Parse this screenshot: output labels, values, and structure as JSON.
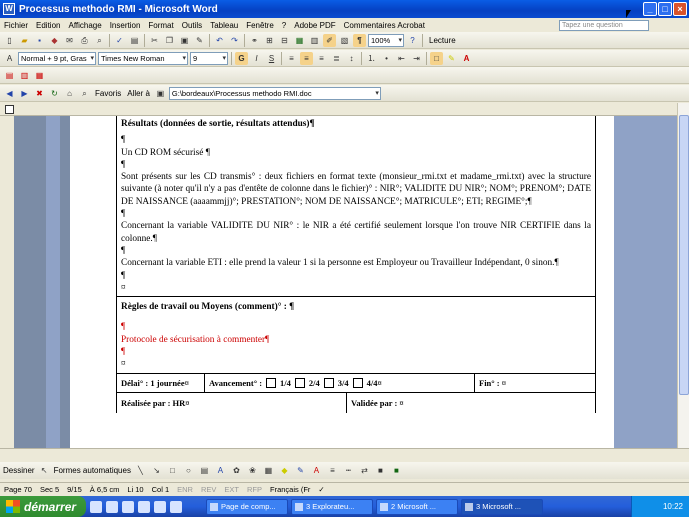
{
  "window": {
    "title": "Processus methodo RMI - Microsoft Word"
  },
  "menu": {
    "items": [
      "Fichier",
      "Edition",
      "Affichage",
      "Insertion",
      "Format",
      "Outils",
      "Tableau",
      "Fenêtre",
      "?",
      "Adobe PDF",
      "Commentaires Acrobat"
    ],
    "help_placeholder": "Tapez une question"
  },
  "toolbar": {
    "zoom": "100%",
    "lecture": "Lecture"
  },
  "format_toolbar": {
    "style": "Normal + 9 pt, Gras",
    "font": "Times New Roman",
    "size": "9",
    "bold": "G",
    "italic": "I",
    "underline": "S"
  },
  "web_toolbar": {
    "favoris": "Favoris",
    "aller": "Aller à",
    "address": "G:\\bordeaux\\Processus methodo RMI.doc"
  },
  "document": {
    "heading1": "Résultats (données de sortie, résultats attendus)¶",
    "para_mark": "¶",
    "cd_line": "Un CD ROM sécurisé ¶",
    "text1": "Sont présents sur les CD transmis° : deux fichiers en format texte (monsieur_rmi.txt et madame_rmi.txt) avec la structure suivante (à noter qu'il n'y a pas d'entête de colonne dans le fichier)° : NIR°; VALIDITE DU NIR°; NOM°; PRENOM°; DATE DE NAISSANCE (aaaammjj)°; PRESTATION°; NOM DE NAISSANCE°; MATRICULE°; ETI; REGIME°;¶",
    "text2": "Concernant la variable VALIDITE DU NIR° : le NIR a été certifié seulement lorsque l'on trouve NIR CERTIFIE dans la colonne.¶",
    "text3": "Concernant la variable ETI : elle prend la valeur 1 si la personne est Employeur ou Travailleur Indépendant, 0 sinon.¶",
    "cell_end": "¤",
    "heading2": "Règles de travail ou Moyens (comment)° : ¶",
    "red_line": "Protocole de sécurisation à commenter¶",
    "delai": "Délai° : 1 journée¤",
    "avancement": "Avancement° :",
    "progress_labels": [
      "1/4",
      "2/4",
      "3/4",
      "4/4¤"
    ],
    "fin": "Fin° : ¤",
    "realisee": "Réalisée par : HR¤",
    "validee": "Validée par : ¤"
  },
  "drawing": {
    "dessiner": "Dessiner",
    "formes": "Formes automatiques"
  },
  "status": {
    "page": "Page 70",
    "sec": "Sec 5",
    "pages": "9/15",
    "at": "À 6,5 cm",
    "li": "Li 10",
    "col": "Col 1",
    "enr": "ENR",
    "rev": "REV",
    "ext": "EXT",
    "rfp": "RFP",
    "lang": "Français (Fr"
  },
  "taskbar": {
    "start": "démarrer",
    "tasks": [
      "Page de comp...",
      "3 Explorateu...",
      "2 Microsoft ...",
      "3 Microsoft ..."
    ],
    "clock": "10:22"
  }
}
